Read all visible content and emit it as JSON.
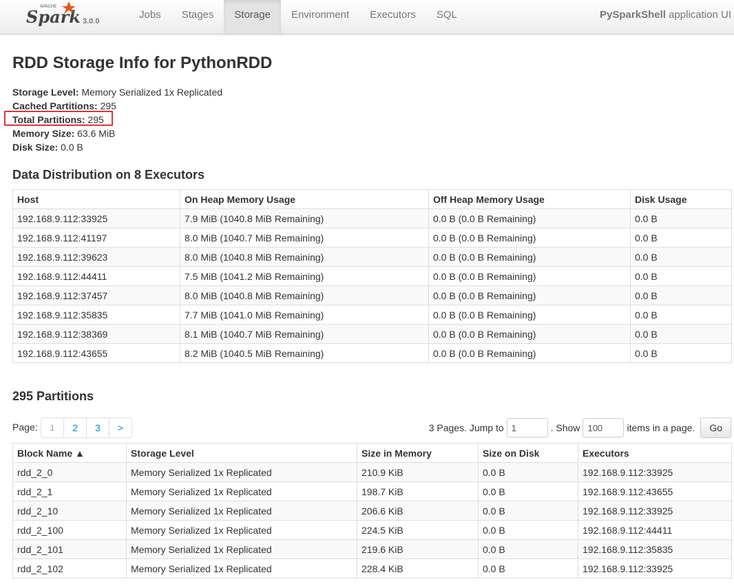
{
  "navbar": {
    "version": "3.0.0",
    "tabs": [
      "Jobs",
      "Stages",
      "Storage",
      "Environment",
      "Executors",
      "SQL"
    ],
    "active_tab": "Storage",
    "app_name": "PySparkShell",
    "app_suffix": "application UI"
  },
  "page": {
    "title": "RDD Storage Info for PythonRDD",
    "summary": [
      {
        "label": "Storage Level:",
        "value": "Memory Serialized 1x Replicated"
      },
      {
        "label": "Cached Partitions:",
        "value": "295"
      },
      {
        "label": "Total Partitions:",
        "value": "295"
      },
      {
        "label": "Memory Size:",
        "value": "63.6 MiB"
      },
      {
        "label": "Disk Size:",
        "value": "0.0 B"
      }
    ]
  },
  "distribution": {
    "heading": "Data Distribution on 8 Executors",
    "columns": [
      "Host",
      "On Heap Memory Usage",
      "Off Heap Memory Usage",
      "Disk Usage"
    ],
    "rows": [
      [
        "192.168.9.112:33925",
        "7.9 MiB (1040.8 MiB Remaining)",
        "0.0 B (0.0 B Remaining)",
        "0.0 B"
      ],
      [
        "192.168.9.112:41197",
        "8.0 MiB (1040.7 MiB Remaining)",
        "0.0 B (0.0 B Remaining)",
        "0.0 B"
      ],
      [
        "192.168.9.112:39623",
        "8.0 MiB (1040.8 MiB Remaining)",
        "0.0 B (0.0 B Remaining)",
        "0.0 B"
      ],
      [
        "192.168.9.112:44411",
        "7.5 MiB (1041.2 MiB Remaining)",
        "0.0 B (0.0 B Remaining)",
        "0.0 B"
      ],
      [
        "192.168.9.112:37457",
        "8.0 MiB (1040.8 MiB Remaining)",
        "0.0 B (0.0 B Remaining)",
        "0.0 B"
      ],
      [
        "192.168.9.112:35835",
        "7.7 MiB (1041.0 MiB Remaining)",
        "0.0 B (0.0 B Remaining)",
        "0.0 B"
      ],
      [
        "192.168.9.112:38369",
        "8.1 MiB (1040.7 MiB Remaining)",
        "0.0 B (0.0 B Remaining)",
        "0.0 B"
      ],
      [
        "192.168.9.112:43655",
        "8.2 MiB (1040.5 MiB Remaining)",
        "0.0 B (0.0 B Remaining)",
        "0.0 B"
      ]
    ]
  },
  "partitions": {
    "heading": "295 Partitions",
    "page_label": "Page:",
    "pages": [
      "1",
      "2",
      "3",
      ">"
    ],
    "pages_text": "3 Pages. Jump to",
    "jump_value": "1",
    "show_text": ". Show",
    "show_value": "100",
    "items_text": "items in a page.",
    "go_label": "Go",
    "columns": [
      "Block Name ▲",
      "Storage Level",
      "Size in Memory",
      "Size on Disk",
      "Executors"
    ],
    "rows": [
      [
        "rdd_2_0",
        "Memory Serialized 1x Replicated",
        "210.9 KiB",
        "0.0 B",
        "192.168.9.112:33925"
      ],
      [
        "rdd_2_1",
        "Memory Serialized 1x Replicated",
        "198.7 KiB",
        "0.0 B",
        "192.168.9.112:43655"
      ],
      [
        "rdd_2_10",
        "Memory Serialized 1x Replicated",
        "206.6 KiB",
        "0.0 B",
        "192.168.9.112:33925"
      ],
      [
        "rdd_2_100",
        "Memory Serialized 1x Replicated",
        "224.5 KiB",
        "0.0 B",
        "192.168.9.112:44411"
      ],
      [
        "rdd_2_101",
        "Memory Serialized 1x Replicated",
        "219.6 KiB",
        "0.0 B",
        "192.168.9.112:35835"
      ],
      [
        "rdd_2_102",
        "Memory Serialized 1x Replicated",
        "228.4 KiB",
        "0.0 B",
        "192.168.9.112:33925"
      ]
    ]
  }
}
